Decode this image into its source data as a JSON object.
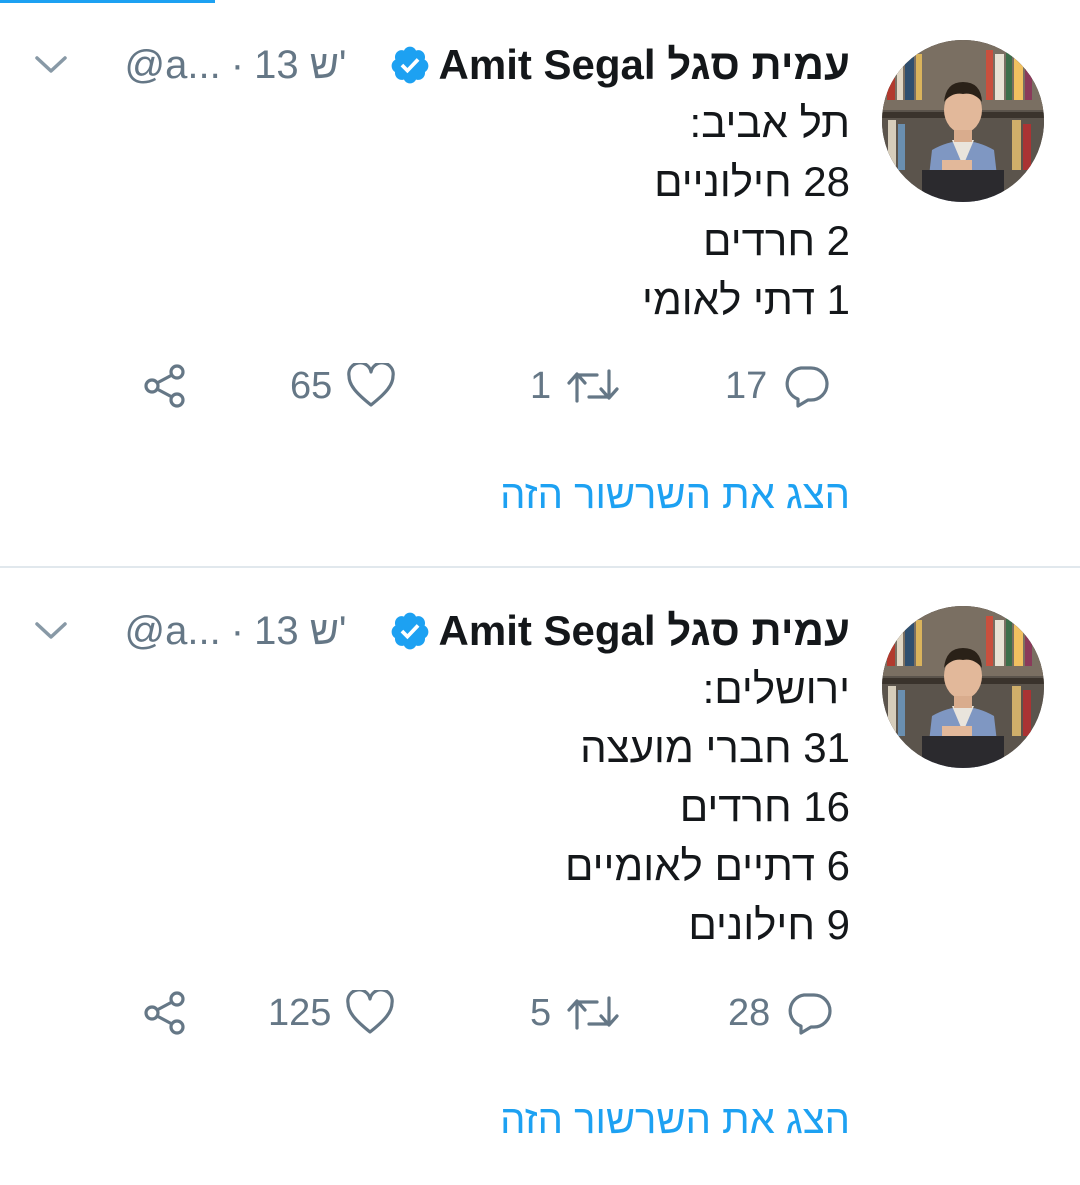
{
  "colors": {
    "accent": "#1da1f2",
    "text": "#14171a",
    "muted": "#657786",
    "divider": "#e1e8ed"
  },
  "tweets": [
    {
      "display_name": "עמית סגל Amit Segal",
      "handle": "@a...",
      "time": "13 ש'",
      "verified_icon": "verified-badge-icon",
      "lines": [
        "תל אביב:",
        "28 חילוניים",
        "2 חרדים",
        "1 דתי לאומי"
      ],
      "replies": "17",
      "retweets": "1",
      "likes": "65",
      "show_thread": "הצג את השרשור הזה"
    },
    {
      "display_name": "עמית סגל Amit Segal",
      "handle": "@a...",
      "time": "13 ש'",
      "verified_icon": "verified-badge-icon",
      "lines": [
        "ירושלים:",
        "31 חברי מועצה",
        "16 חרדים",
        "6 דתיים לאומיים",
        "9 חילונים"
      ],
      "replies": "28",
      "retweets": "5",
      "likes": "125",
      "show_thread": "הצג את השרשור הזה"
    }
  ]
}
